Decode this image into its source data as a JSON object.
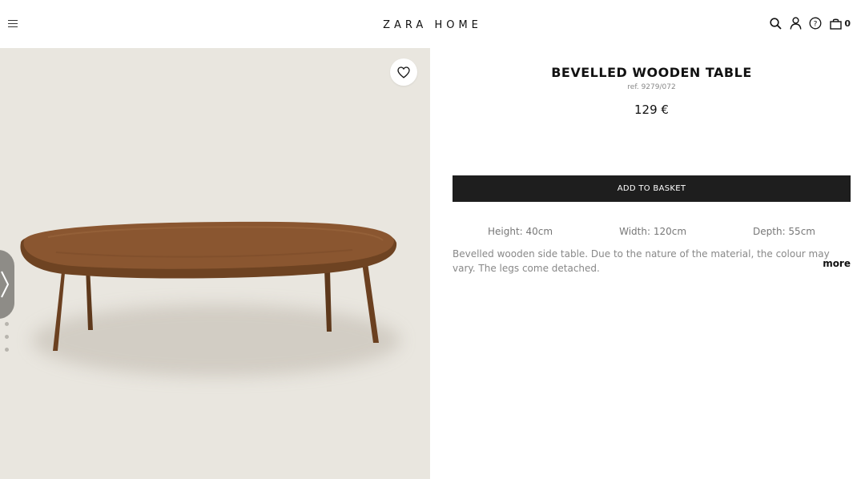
{
  "header": {
    "brand": "ZARA HOME",
    "icons": [
      "menu-icon",
      "search-icon",
      "user-icon",
      "help-icon",
      "basket-icon"
    ],
    "basket_count": "0"
  },
  "gallery": {
    "favorite_icon": "heart-icon",
    "next_icon": "chevron-right-icon",
    "dots_count": 3
  },
  "product": {
    "title": "BEVELLED WOODEN TABLE",
    "ref": "ref. 9279/072",
    "price": "129 €",
    "add_to_basket": "ADD TO BASKET",
    "dimensions": {
      "height": "Height: 40cm",
      "width": "Width: 120cm",
      "depth": "Depth: 55cm"
    },
    "description": "Bevelled wooden side table. Due to the nature of the material, the colour may vary. The legs come detached.",
    "more": "more"
  },
  "colors": {
    "button_bg": "#1e1e1e",
    "image_bg": "#e9e6df",
    "wood": "#8a5630"
  }
}
